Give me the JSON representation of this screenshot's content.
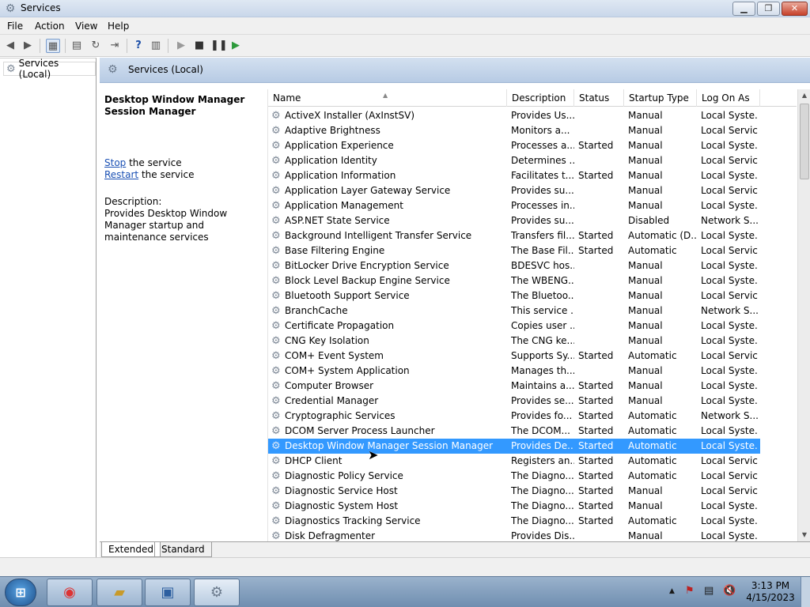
{
  "window": {
    "title": "Services",
    "minimize_icon": "minimize-icon",
    "maximize_icon": "maximize-icon",
    "close_icon": "close-icon"
  },
  "menu": [
    "File",
    "Action",
    "View",
    "Help"
  ],
  "tree": {
    "label": "Services (Local)"
  },
  "pane": {
    "title": "Services (Local)"
  },
  "info": {
    "title": "Desktop Window Manager Session Manager",
    "stop_link": "Stop",
    "stop_suffix": " the service",
    "restart_link": "Restart",
    "restart_suffix": " the service",
    "description_label": "Description:",
    "description": "Provides Desktop Window Manager startup and maintenance services"
  },
  "columns": {
    "name": "Name",
    "description": "Description",
    "status": "Status",
    "startup_type": "Startup Type",
    "log_on_as": "Log On As"
  },
  "services": [
    {
      "name": "ActiveX Installer (AxInstSV)",
      "description": "Provides Us...",
      "status": "",
      "startup": "Manual",
      "logon": "Local Syste..."
    },
    {
      "name": "Adaptive Brightness",
      "description": "Monitors a...",
      "status": "",
      "startup": "Manual",
      "logon": "Local Service"
    },
    {
      "name": "Application Experience",
      "description": "Processes a...",
      "status": "Started",
      "startup": "Manual",
      "logon": "Local Syste..."
    },
    {
      "name": "Application Identity",
      "description": "Determines ...",
      "status": "",
      "startup": "Manual",
      "logon": "Local Service"
    },
    {
      "name": "Application Information",
      "description": "Facilitates t...",
      "status": "Started",
      "startup": "Manual",
      "logon": "Local Syste..."
    },
    {
      "name": "Application Layer Gateway Service",
      "description": "Provides su...",
      "status": "",
      "startup": "Manual",
      "logon": "Local Service"
    },
    {
      "name": "Application Management",
      "description": "Processes in...",
      "status": "",
      "startup": "Manual",
      "logon": "Local Syste..."
    },
    {
      "name": "ASP.NET State Service",
      "description": "Provides su...",
      "status": "",
      "startup": "Disabled",
      "logon": "Network S..."
    },
    {
      "name": "Background Intelligent Transfer Service",
      "description": "Transfers fil...",
      "status": "Started",
      "startup": "Automatic (D...",
      "logon": "Local Syste..."
    },
    {
      "name": "Base Filtering Engine",
      "description": "The Base Fil...",
      "status": "Started",
      "startup": "Automatic",
      "logon": "Local Service"
    },
    {
      "name": "BitLocker Drive Encryption Service",
      "description": "BDESVC hos...",
      "status": "",
      "startup": "Manual",
      "logon": "Local Syste..."
    },
    {
      "name": "Block Level Backup Engine Service",
      "description": "The WBENG...",
      "status": "",
      "startup": "Manual",
      "logon": "Local Syste..."
    },
    {
      "name": "Bluetooth Support Service",
      "description": "The Bluetoo...",
      "status": "",
      "startup": "Manual",
      "logon": "Local Service"
    },
    {
      "name": "BranchCache",
      "description": "This service ...",
      "status": "",
      "startup": "Manual",
      "logon": "Network S..."
    },
    {
      "name": "Certificate Propagation",
      "description": "Copies user ...",
      "status": "",
      "startup": "Manual",
      "logon": "Local Syste..."
    },
    {
      "name": "CNG Key Isolation",
      "description": "The CNG ke...",
      "status": "",
      "startup": "Manual",
      "logon": "Local Syste..."
    },
    {
      "name": "COM+ Event System",
      "description": "Supports Sy...",
      "status": "Started",
      "startup": "Automatic",
      "logon": "Local Service"
    },
    {
      "name": "COM+ System Application",
      "description": "Manages th...",
      "status": "",
      "startup": "Manual",
      "logon": "Local Syste..."
    },
    {
      "name": "Computer Browser",
      "description": "Maintains a...",
      "status": "Started",
      "startup": "Manual",
      "logon": "Local Syste..."
    },
    {
      "name": "Credential Manager",
      "description": "Provides se...",
      "status": "Started",
      "startup": "Manual",
      "logon": "Local Syste..."
    },
    {
      "name": "Cryptographic Services",
      "description": "Provides fo...",
      "status": "Started",
      "startup": "Automatic",
      "logon": "Network S..."
    },
    {
      "name": "DCOM Server Process Launcher",
      "description": "The DCOM...",
      "status": "Started",
      "startup": "Automatic",
      "logon": "Local Syste..."
    },
    {
      "name": "Desktop Window Manager Session Manager",
      "description": "Provides De...",
      "status": "Started",
      "startup": "Automatic",
      "logon": "Local Syste...",
      "selected": true
    },
    {
      "name": "DHCP Client",
      "description": "Registers an...",
      "status": "Started",
      "startup": "Automatic",
      "logon": "Local Service"
    },
    {
      "name": "Diagnostic Policy Service",
      "description": "The Diagno...",
      "status": "Started",
      "startup": "Automatic",
      "logon": "Local Service"
    },
    {
      "name": "Diagnostic Service Host",
      "description": "The Diagno...",
      "status": "Started",
      "startup": "Manual",
      "logon": "Local Service"
    },
    {
      "name": "Diagnostic System Host",
      "description": "The Diagno...",
      "status": "Started",
      "startup": "Manual",
      "logon": "Local Syste..."
    },
    {
      "name": "Diagnostics Tracking Service",
      "description": "The Diagno...",
      "status": "Started",
      "startup": "Automatic",
      "logon": "Local Syste..."
    },
    {
      "name": "Disk Defragmenter",
      "description": "Provides Dis...",
      "status": "",
      "startup": "Manual",
      "logon": "Local Syste..."
    }
  ],
  "tabs": [
    "Extended",
    "Standard"
  ],
  "taskbar": {
    "time": "3:13 PM",
    "date": "4/15/2023"
  }
}
